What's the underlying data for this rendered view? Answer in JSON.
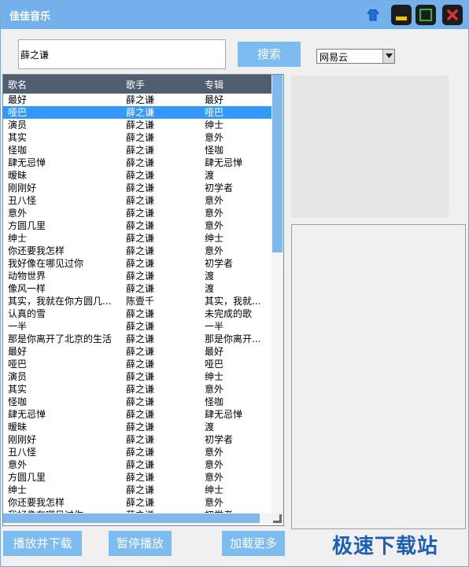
{
  "window": {
    "title": "佳佳音乐",
    "accent_color": "#74b1ec"
  },
  "search": {
    "query": "薛之谦",
    "button_label": "搜索",
    "source_selected": "网易云"
  },
  "song_list": {
    "columns": [
      "歌名",
      "歌手",
      "专辑"
    ],
    "selected_index": 1,
    "rows": [
      [
        "最好",
        "薛之谦",
        "最好"
      ],
      [
        "哑巴",
        "薛之谦",
        "哑巴"
      ],
      [
        "演员",
        "薛之谦",
        "绅士"
      ],
      [
        "其实",
        "薛之谦",
        "意外"
      ],
      [
        "怪咖",
        "薛之谦",
        "怪咖"
      ],
      [
        "肆无忌惮",
        "薛之谦",
        "肆无忌惮"
      ],
      [
        "暧昧",
        "薛之谦",
        "渡"
      ],
      [
        "刚刚好",
        "薛之谦",
        "初学者"
      ],
      [
        "丑八怪",
        "薛之谦",
        "意外"
      ],
      [
        "意外",
        "薛之谦",
        "意外"
      ],
      [
        "方圆几里",
        "薛之谦",
        "意外"
      ],
      [
        "绅士",
        "薛之谦",
        "绅士"
      ],
      [
        "你还要我怎样",
        "薛之谦",
        "意外"
      ],
      [
        "我好像在哪见过你",
        "薛之谦",
        "初学者"
      ],
      [
        "动物世界",
        "薛之谦",
        "渡"
      ],
      [
        "像风一样",
        "薛之谦",
        "渡"
      ],
      [
        "其实，我就在你方圆几...",
        "陈壹千",
        "其实，我就..."
      ],
      [
        "认真的雪",
        "薛之谦",
        "未完成的歌"
      ],
      [
        "一半",
        "薛之谦",
        "一半"
      ],
      [
        "那是你离开了北京的生活",
        "薛之谦",
        "那是你离开..."
      ],
      [
        "最好",
        "薛之谦",
        "最好"
      ],
      [
        "哑巴",
        "薛之谦",
        "哑巴"
      ],
      [
        "演员",
        "薛之谦",
        "绅士"
      ],
      [
        "其实",
        "薛之谦",
        "意外"
      ],
      [
        "怪咖",
        "薛之谦",
        "怪咖"
      ],
      [
        "肆无忌惮",
        "薛之谦",
        "肆无忌惮"
      ],
      [
        "暧昧",
        "薛之谦",
        "渡"
      ],
      [
        "刚刚好",
        "薛之谦",
        "初学者"
      ],
      [
        "丑八怪",
        "薛之谦",
        "意外"
      ],
      [
        "意外",
        "薛之谦",
        "意外"
      ],
      [
        "方圆几里",
        "薛之谦",
        "意外"
      ],
      [
        "绅士",
        "薛之谦",
        "绅士"
      ],
      [
        "你还要我怎样",
        "薛之谦",
        "意外"
      ],
      [
        "我好像在哪见过你",
        "薛之谦",
        "初学者"
      ]
    ]
  },
  "actions": {
    "play_download": "播放并下载",
    "pause": "暂停播放",
    "load_more": "加载更多"
  },
  "watermark": "极速下载站",
  "icons": [
    "skin-icon",
    "minimize-icon",
    "maximize-icon",
    "close-icon",
    "chevron-down-icon"
  ]
}
